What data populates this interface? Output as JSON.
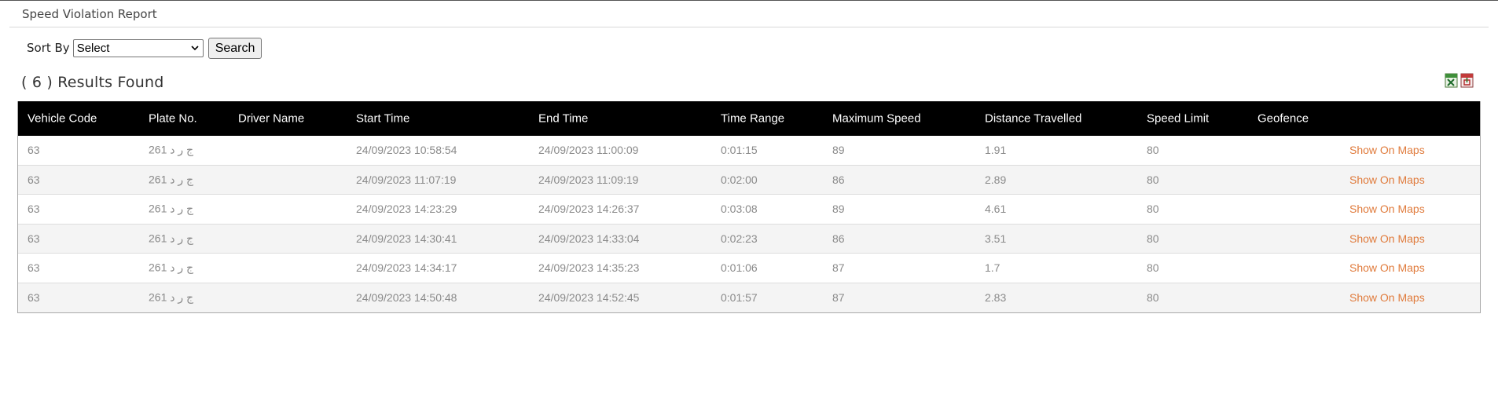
{
  "page_title": "Speed Violation Report",
  "sort": {
    "label": "Sort By",
    "selected": "Select",
    "search_label": "Search"
  },
  "results": {
    "heading": "( 6 ) Results Found"
  },
  "export": {
    "icons": [
      "excel-export-icon",
      "pdf-export-icon"
    ]
  },
  "table": {
    "columns": [
      "Vehicle Code",
      "Plate No.",
      "Driver Name",
      "Start Time",
      "End Time",
      "Time Range",
      "Maximum Speed",
      "Distance Travelled",
      "Speed Limit",
      "Geofence",
      ""
    ],
    "rows": [
      {
        "vehicle_code": "63",
        "plate_no": "261 ج ر د",
        "driver_name": "",
        "start_time": "24/09/2023 10:58:54",
        "end_time": "24/09/2023 11:00:09",
        "time_range": "0:01:15",
        "max_speed": "89",
        "distance": "1.91",
        "speed_limit": "80",
        "geofence": "",
        "action": "Show On Maps"
      },
      {
        "vehicle_code": "63",
        "plate_no": "261 ج ر د",
        "driver_name": "",
        "start_time": "24/09/2023 11:07:19",
        "end_time": "24/09/2023 11:09:19",
        "time_range": "0:02:00",
        "max_speed": "86",
        "distance": "2.89",
        "speed_limit": "80",
        "geofence": "",
        "action": "Show On Maps"
      },
      {
        "vehicle_code": "63",
        "plate_no": "261 ج ر د",
        "driver_name": "",
        "start_time": "24/09/2023 14:23:29",
        "end_time": "24/09/2023 14:26:37",
        "time_range": "0:03:08",
        "max_speed": "89",
        "distance": "4.61",
        "speed_limit": "80",
        "geofence": "",
        "action": "Show On Maps"
      },
      {
        "vehicle_code": "63",
        "plate_no": "261 ج ر د",
        "driver_name": "",
        "start_time": "24/09/2023 14:30:41",
        "end_time": "24/09/2023 14:33:04",
        "time_range": "0:02:23",
        "max_speed": "86",
        "distance": "3.51",
        "speed_limit": "80",
        "geofence": "",
        "action": "Show On Maps"
      },
      {
        "vehicle_code": "63",
        "plate_no": "261 ج ر د",
        "driver_name": "",
        "start_time": "24/09/2023 14:34:17",
        "end_time": "24/09/2023 14:35:23",
        "time_range": "0:01:06",
        "max_speed": "87",
        "distance": "1.7",
        "speed_limit": "80",
        "geofence": "",
        "action": "Show On Maps"
      },
      {
        "vehicle_code": "63",
        "plate_no": "261 ج ر د",
        "driver_name": "",
        "start_time": "24/09/2023 14:50:48",
        "end_time": "24/09/2023 14:52:45",
        "time_range": "0:01:57",
        "max_speed": "87",
        "distance": "2.83",
        "speed_limit": "80",
        "geofence": "",
        "action": "Show On Maps"
      }
    ]
  },
  "colors": {
    "header_bg": "#000000",
    "header_text": "#ffffff",
    "cell_text": "#8a8a8a",
    "link": "#e07b3c",
    "row_alt": "#f4f4f4"
  }
}
